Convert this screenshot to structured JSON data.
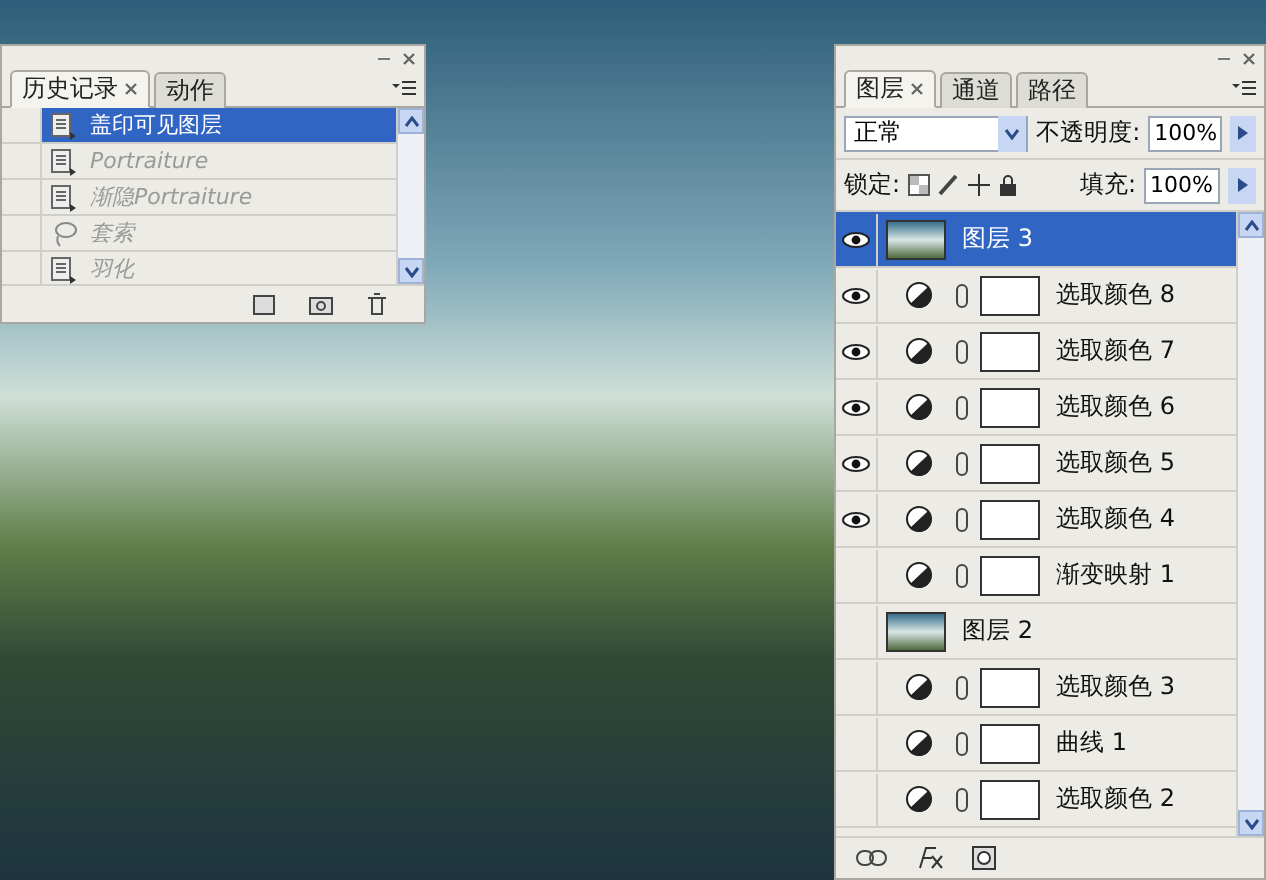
{
  "history_panel": {
    "tabs": [
      {
        "label": "历史记录",
        "selected": true
      },
      {
        "label": "动作",
        "selected": false
      }
    ],
    "items": [
      {
        "label": "盖印可见图层",
        "kind": "command",
        "selected": true,
        "dimmed": false
      },
      {
        "label": "Portraiture",
        "kind": "command",
        "selected": false,
        "dimmed": true
      },
      {
        "label": "渐隐Portraiture",
        "kind": "command",
        "selected": false,
        "dimmed": true
      },
      {
        "label": "套索",
        "kind": "lasso",
        "selected": false,
        "dimmed": true
      },
      {
        "label": "羽化",
        "kind": "command",
        "selected": false,
        "dimmed": true
      }
    ]
  },
  "layers_panel": {
    "tabs": [
      {
        "label": "图层",
        "selected": true
      },
      {
        "label": "通道",
        "selected": false
      },
      {
        "label": "路径",
        "selected": false
      }
    ],
    "blend_mode": "正常",
    "opacity_label": "不透明度:",
    "opacity": "100%",
    "lock_label": "锁定:",
    "fill_label": "填充:",
    "fill": "100%",
    "layers": [
      {
        "name": "图层 3",
        "kind": "pixel",
        "visible": true,
        "selected": true
      },
      {
        "name": "选取颜色 8",
        "kind": "adjustment",
        "visible": true,
        "selected": false
      },
      {
        "name": "选取颜色 7",
        "kind": "adjustment",
        "visible": true,
        "selected": false
      },
      {
        "name": "选取颜色 6",
        "kind": "adjustment",
        "visible": true,
        "selected": false
      },
      {
        "name": "选取颜色 5",
        "kind": "adjustment",
        "visible": true,
        "selected": false
      },
      {
        "name": "选取颜色 4",
        "kind": "adjustment",
        "visible": true,
        "selected": false
      },
      {
        "name": "渐变映射 1",
        "kind": "adjustment",
        "visible": false,
        "selected": false
      },
      {
        "name": "图层 2",
        "kind": "pixel",
        "visible": false,
        "selected": false
      },
      {
        "name": "选取颜色 3",
        "kind": "adjustment",
        "visible": false,
        "selected": false
      },
      {
        "name": "曲线 1",
        "kind": "adjustment",
        "visible": false,
        "selected": false
      },
      {
        "name": "选取颜色 2",
        "kind": "adjustment",
        "visible": false,
        "selected": false
      }
    ]
  }
}
